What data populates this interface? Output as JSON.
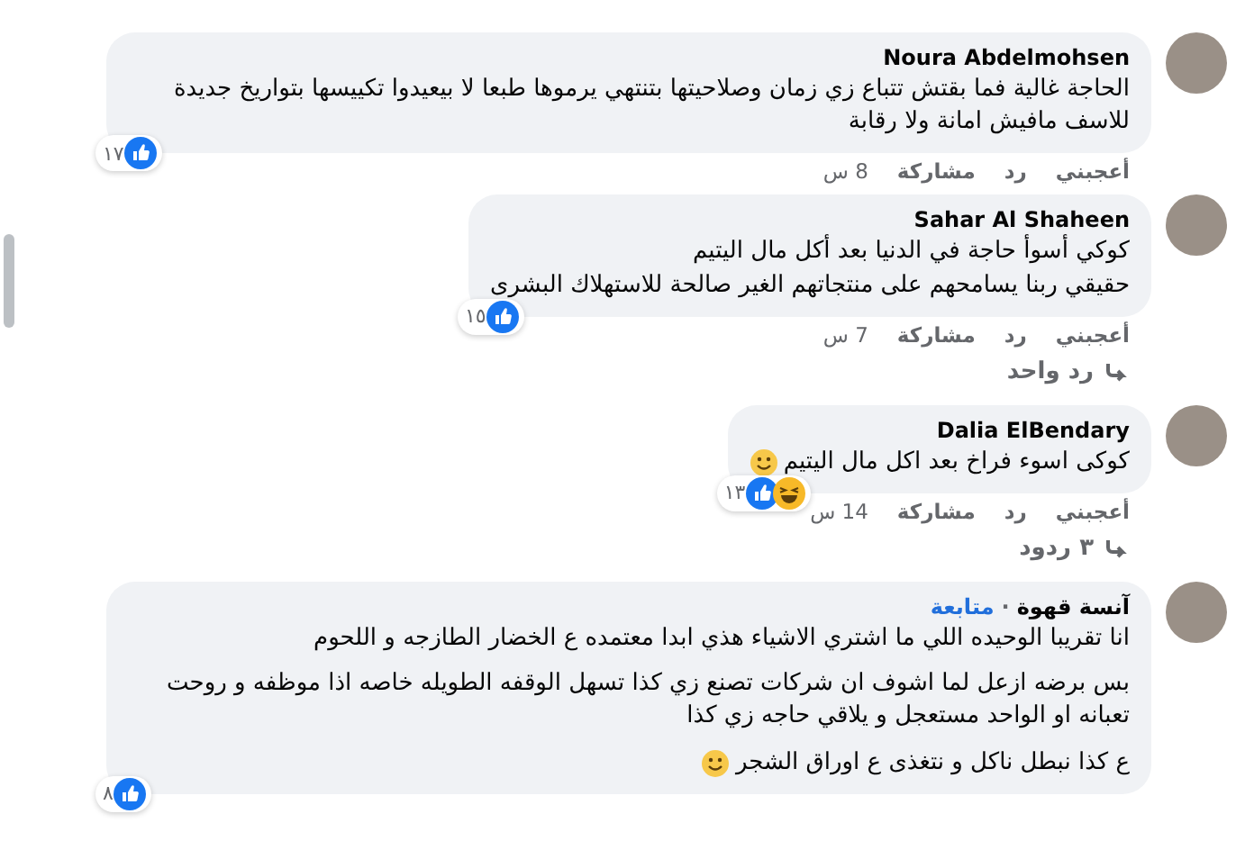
{
  "comments": [
    {
      "author": "Noura Abdelmohsen",
      "paragraphs": [
        {
          "lines": [
            "الحاجة غالية فما بقتش تتباع زي زمان وصلاحيتها بتنتهي يرموها طبعا لا بيعيدوا تكييسها بتواريخ جديدة للاسف مافيش امانة ولا رقابة"
          ],
          "smiley": false
        }
      ],
      "reactions": [
        {
          "kind": "like"
        }
      ],
      "reaction_count": "١٧",
      "actions": [
        "أعجبني",
        "رد",
        "مشاركة"
      ],
      "time": "8 س"
    },
    {
      "author": "Sahar Al Shaheen",
      "paragraphs": [
        {
          "lines": [
            "كوكي أسوأ حاجة في الدنيا بعد أكل مال اليتيم",
            "حقيقي ربنا يسامحهم على منتجاتهم الغير صالحة للاستهلاك البشرى"
          ],
          "smiley": false
        }
      ],
      "reactions": [
        {
          "kind": "like"
        }
      ],
      "reaction_count": "١٥",
      "actions": [
        "أعجبني",
        "رد",
        "مشاركة"
      ],
      "time": "7 س",
      "replies_link": "رد واحد"
    },
    {
      "author": "Dalia ElBendary",
      "paragraphs": [
        {
          "lines": [
            "كوكى اسوء فراخ بعد اكل مال اليتيم"
          ],
          "smiley": true
        }
      ],
      "reactions": [
        {
          "kind": "like"
        },
        {
          "kind": "haha"
        }
      ],
      "reaction_count": "١٣",
      "actions": [
        "أعجبني",
        "رد",
        "مشاركة"
      ],
      "time": "14 س",
      "replies_link": "٣ ردود"
    },
    {
      "author": "آنسة قهوة",
      "author_separator": "·",
      "follow_label": "متابعة",
      "paragraphs": [
        {
          "lines": [
            "انا تقريبا الوحيده اللي ما اشتري الاشياء هذي ابدا معتمده ع الخضار الطازجه و اللحوم"
          ],
          "smiley": false
        },
        {
          "lines": [
            "بس برضه ازعل لما اشوف ان شركات تصنع زي كذا تسهل الوقفه الطويله خاصه اذا موظفه و روحت تعبانه او الواحد مستعجل و يلاقي حاجه زي كذا"
          ],
          "smiley": false
        },
        {
          "lines": [
            "ع كذا نبطل ناكل و نتغذى ع اوراق الشجر"
          ],
          "smiley": true
        }
      ],
      "reactions": [
        {
          "kind": "like"
        }
      ],
      "reaction_count": "٨"
    }
  ]
}
